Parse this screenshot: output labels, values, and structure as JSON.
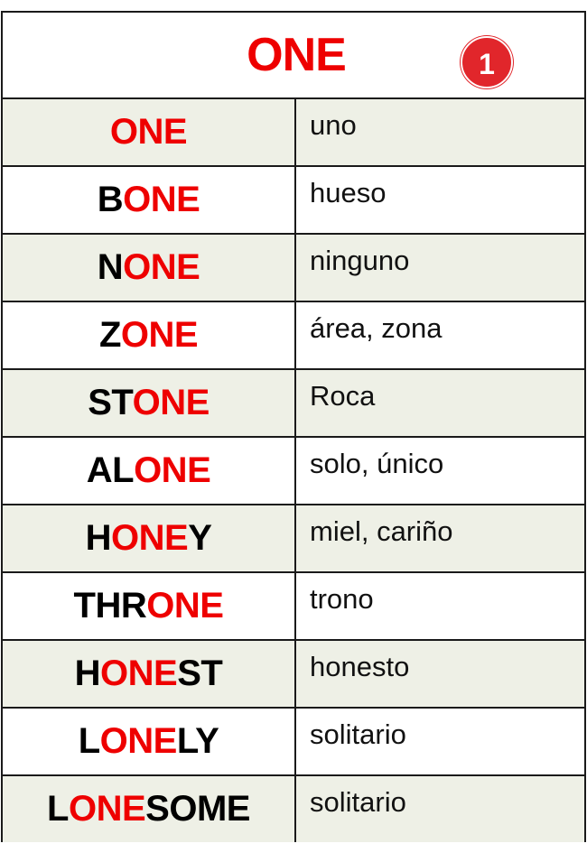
{
  "header": {
    "title": "ONE",
    "badge": "1"
  },
  "colors": {
    "accent_red": "#ee0000",
    "text_black": "#000000",
    "shaded_row": "#eef0e6",
    "badge_red": "#e1262b"
  },
  "rows": [
    {
      "segments": [
        {
          "t": "ONE",
          "c": "r"
        }
      ],
      "translation": "uno"
    },
    {
      "segments": [
        {
          "t": "B",
          "c": "b"
        },
        {
          "t": "ONE",
          "c": "r"
        }
      ],
      "translation": "hueso"
    },
    {
      "segments": [
        {
          "t": "N",
          "c": "b"
        },
        {
          "t": "ONE",
          "c": "r"
        }
      ],
      "translation": "ninguno"
    },
    {
      "segments": [
        {
          "t": "Z",
          "c": "b"
        },
        {
          "t": "ONE",
          "c": "r"
        }
      ],
      "translation": "área, zona"
    },
    {
      "segments": [
        {
          "t": "ST",
          "c": "b"
        },
        {
          "t": "ONE",
          "c": "r"
        }
      ],
      "translation": "Roca"
    },
    {
      "segments": [
        {
          "t": "AL",
          "c": "b"
        },
        {
          "t": "ONE",
          "c": "r"
        }
      ],
      "translation": "solo, único"
    },
    {
      "segments": [
        {
          "t": "H",
          "c": "b"
        },
        {
          "t": "ONE",
          "c": "r"
        },
        {
          "t": "Y",
          "c": "b"
        }
      ],
      "translation": "miel, cariño"
    },
    {
      "segments": [
        {
          "t": "THR",
          "c": "b"
        },
        {
          "t": "ONE",
          "c": "r"
        }
      ],
      "translation": "trono"
    },
    {
      "segments": [
        {
          "t": "H",
          "c": "b"
        },
        {
          "t": "ONE",
          "c": "r"
        },
        {
          "t": "ST",
          "c": "b"
        }
      ],
      "translation": "honesto"
    },
    {
      "segments": [
        {
          "t": "L",
          "c": "b"
        },
        {
          "t": "ONE",
          "c": "r"
        },
        {
          "t": "LY",
          "c": "b"
        }
      ],
      "translation": "solitario"
    },
    {
      "segments": [
        {
          "t": "L",
          "c": "b"
        },
        {
          "t": "ONE",
          "c": "r"
        },
        {
          "t": "SOME",
          "c": "b"
        }
      ],
      "translation": "solitario"
    }
  ]
}
